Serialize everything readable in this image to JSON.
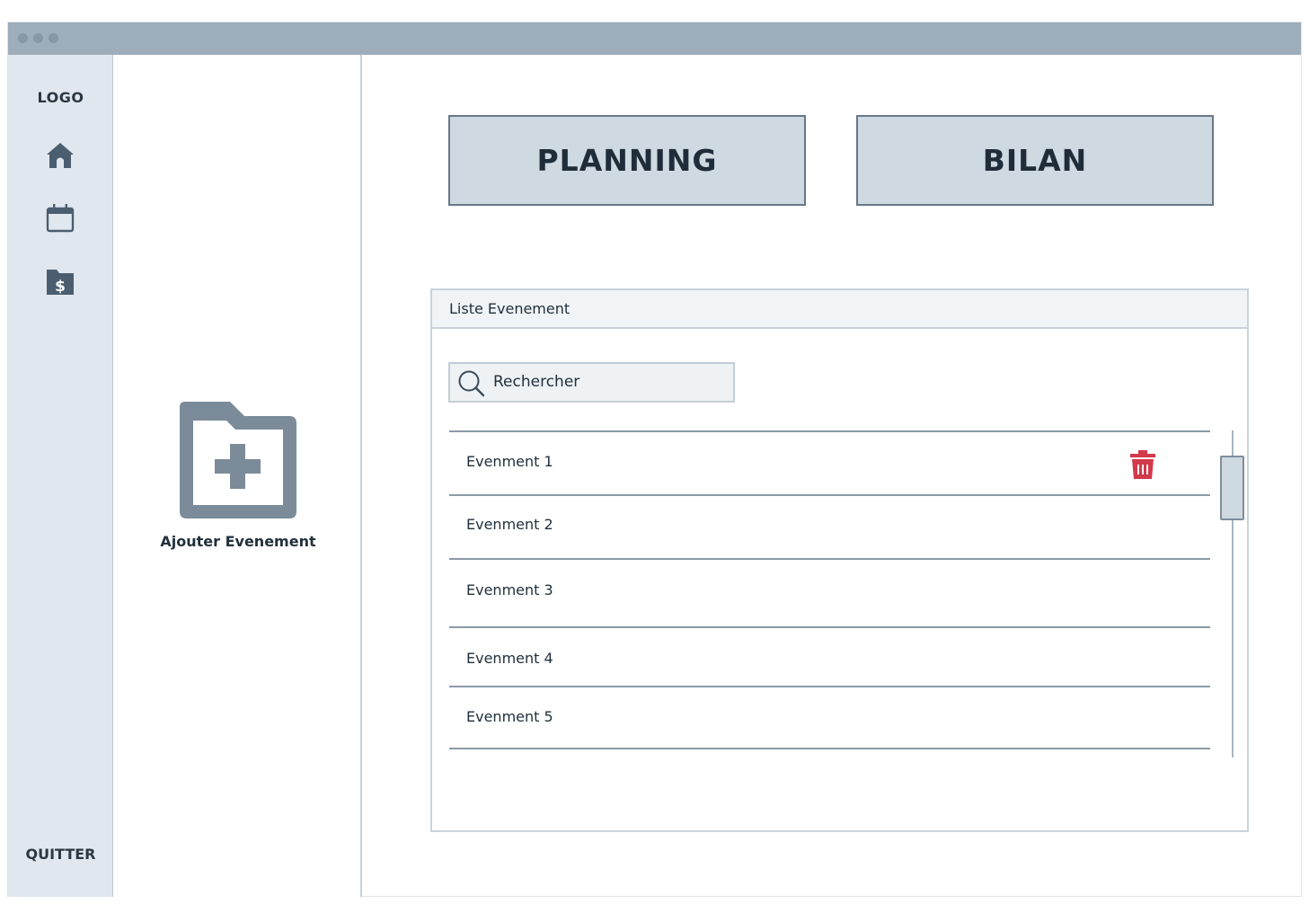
{
  "colors": {
    "titlebar": "#9dadba",
    "sidebar": "#e1e7ee",
    "button_fill": "#cfd9e1",
    "button_border": "#67788a",
    "icon": "#55687a",
    "delete": "#d2394b"
  },
  "sidebar": {
    "logo": "LOGO",
    "nav_icons": [
      "home-icon",
      "calendar-icon",
      "finance-folder-icon"
    ],
    "quit_label": "QUITTER"
  },
  "left_panel": {
    "add_icon": "folder-plus-icon",
    "add_label": "Ajouter Evenement"
  },
  "actions": {
    "planning_label": "PLANNING",
    "bilan_label": "BILAN"
  },
  "event_list": {
    "title": "Liste Evenement",
    "search_placeholder": "Rechercher",
    "items": [
      {
        "label": "Evenment 1",
        "delete_icon": "trash-icon"
      },
      {
        "label": "Evenment 2"
      },
      {
        "label": "Evenment 3"
      },
      {
        "label": "Evenment 4"
      },
      {
        "label": "Evenment 5"
      }
    ]
  }
}
